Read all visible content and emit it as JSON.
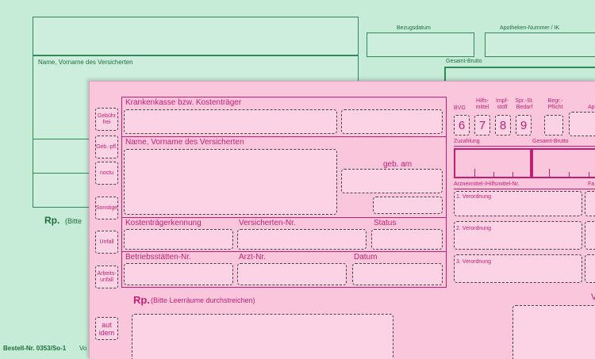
{
  "green_form": {
    "name_label": "Name, Vorname des Versicherten",
    "bezugsdatum_label": "Bezugsdatum",
    "apotheken_label": "Apotheken-Nummer / IK",
    "gesamt_brutto_label": "Gesamt-Brutto",
    "rp_label": "Rp.",
    "rp_hint": "(Bitte",
    "bestell_nr": "Bestell-Nr. 0353/So-1",
    "bestell_suffix": "Vo"
  },
  "pink_form": {
    "side_boxes": [
      "Gebühr frei",
      "Geb.-pfl.",
      "noctu",
      "Sonstige",
      "Unfall",
      "Arbeits-unfall"
    ],
    "krankenkasse_label": "Krankenkasse bzw. Kostenträger",
    "name_label": "Name, Vorname des Versicherten",
    "geb_am_label": "geb. am",
    "kostentraeger_label": "Kostenträgerkennung",
    "versicherten_label": "Versicherten-Nr.",
    "status_label": "Status",
    "betriebsstaetten_label": "Betriebsstätten-Nr.",
    "arzt_label": "Arzt-Nr.",
    "datum_label": "Datum",
    "rp_label": "Rp.",
    "rp_hint": "(Bitte Leerräume durchstreichen)",
    "aut_idem_label": "aut idem",
    "bvg_label": "BVG",
    "hilfsmittel_label": "Hilfs- mittel",
    "impfstoff_label": "Impf- stoff",
    "spr_label": "Spr.-St. Bedarf",
    "begr_label": "Begr.- Pflicht",
    "ap_label": "Ap",
    "num_6": "6",
    "num_7": "7",
    "num_8": "8",
    "num_9": "9",
    "zuzahlung_label": "Zuzahlung",
    "gesamt_brutto_label": "Gesamt-Brutto",
    "arzneimittel_label": "Arzneimittel-/Hilfsmittel-Nr.",
    "fa_label": "Fa",
    "verordnung_1": "1. Verordnung",
    "verordnung_2": "2. Verordnung",
    "verordnung_3": "3. Verordnung",
    "v_label": "V"
  }
}
